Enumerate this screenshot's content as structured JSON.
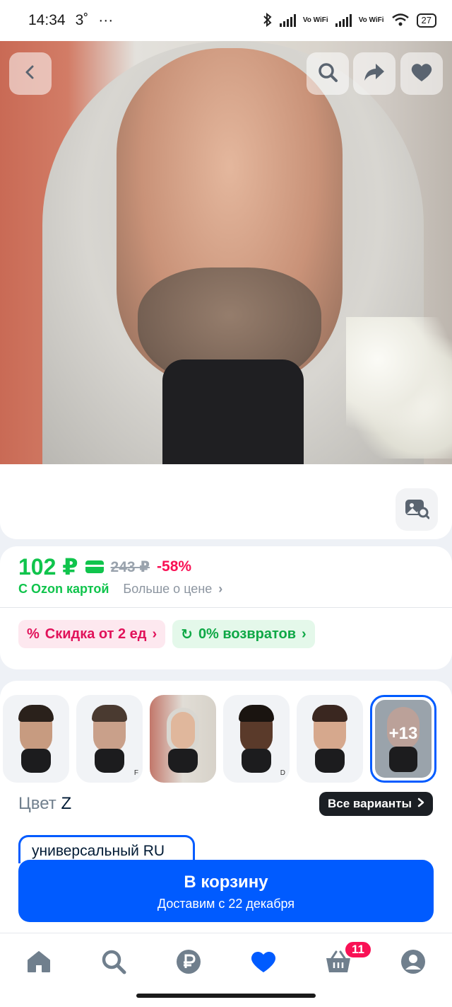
{
  "status_bar": {
    "time": "14:34",
    "temperature": "3˚",
    "more": "···",
    "vowifi_1": "Vo WiFi",
    "vowifi_2": "Vo WiFi",
    "battery": "27"
  },
  "hero": {
    "icons": [
      "back-icon",
      "search-icon",
      "share-icon",
      "heart-icon"
    ],
    "reverse_search_icon": "image-search-icon"
  },
  "price": {
    "current": "102 ₽",
    "old": "243 ₽",
    "discount": "-58%",
    "ozon_card_label": "С Ozon картой",
    "more_about_price": "Больше о цене",
    "chevron": "›"
  },
  "badges": [
    {
      "icon": "%",
      "label": "Скидка от 2 ед",
      "chevron": "›"
    },
    {
      "icon": "↻",
      "label": "0% возвратов",
      "chevron": "›"
    }
  ],
  "variants": {
    "thumb_tags": [
      "",
      "F",
      "",
      "D",
      ""
    ],
    "more_count": "+13",
    "color_label": "Цвет",
    "color_value": "Z",
    "all_variants": "Все варианты",
    "size_chip": "универсальный RU"
  },
  "cart_button": {
    "title": "В корзину",
    "subtitle": "Доставим с 22 декабря"
  },
  "bottom_nav": {
    "cart_count": "11",
    "items": [
      "home-icon",
      "search-icon",
      "ruble-icon",
      "heart-icon",
      "basket-icon",
      "profile-icon"
    ]
  },
  "colors": {
    "accent": "#005bff",
    "green": "#10c44c",
    "pink": "#f91155"
  }
}
